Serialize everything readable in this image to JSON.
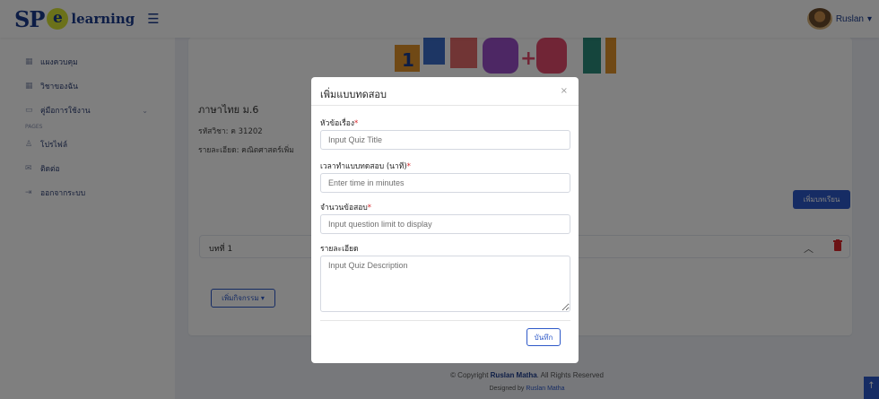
{
  "brand": {
    "sp": "SP",
    "e": "e",
    "text": "learning"
  },
  "user": {
    "name": "Ruslan"
  },
  "sidebar": {
    "items": [
      {
        "label": "แผงควบคุม",
        "icon": "grid-icon"
      },
      {
        "label": "วิชาของฉัน",
        "icon": "grid-icon"
      },
      {
        "label": "คู่มือการใช้งาน",
        "icon": "book-icon"
      }
    ],
    "heading": "PAGES",
    "pages": [
      {
        "label": "โปรไฟล์",
        "icon": "user-icon"
      },
      {
        "label": "ติดต่อ",
        "icon": "mail-icon"
      },
      {
        "label": "ออกจากระบบ",
        "icon": "logout-icon"
      }
    ]
  },
  "course": {
    "title": "ภาษาไทย ม.6",
    "code": "รหัสวิชา: ค 31202",
    "description": "รายละเอียด: คณิตศาสตร์เพิ่ม"
  },
  "add_lesson_label": "เพิ่มบทเรียน",
  "lesson": {
    "title": "บทที่ 1"
  },
  "add_activity_label": "เพิ่มกิจกรรม ▾",
  "footer": {
    "prefix": "© Copyright",
    "name": "Ruslan Matha",
    "suffix": ". All Rights Reserved",
    "designed_prefix": "Designed by",
    "designed_name": "Ruslan Matha"
  },
  "modal": {
    "title": "เพิ่มแบบทดสอบ",
    "close": "×",
    "fields": {
      "title": {
        "label": "หัวข้อเรื่อง",
        "placeholder": "Input Quiz Title",
        "value": ""
      },
      "time": {
        "label": "เวลาทำแบบทดสอบ (นาที)",
        "placeholder": "Enter time in minutes",
        "value": ""
      },
      "limit": {
        "label": "จำนวนข้อสอบ",
        "placeholder": "Input question limit to display",
        "value": ""
      },
      "description": {
        "label": "รายละเอียด",
        "placeholder": "Input Quiz Description",
        "value": ""
      }
    },
    "required_mark": "*",
    "save_label": "บันทึก"
  },
  "colors": {
    "primary": "#2d58c8",
    "required": "#d8262a",
    "brand": "#1a3b8c"
  }
}
